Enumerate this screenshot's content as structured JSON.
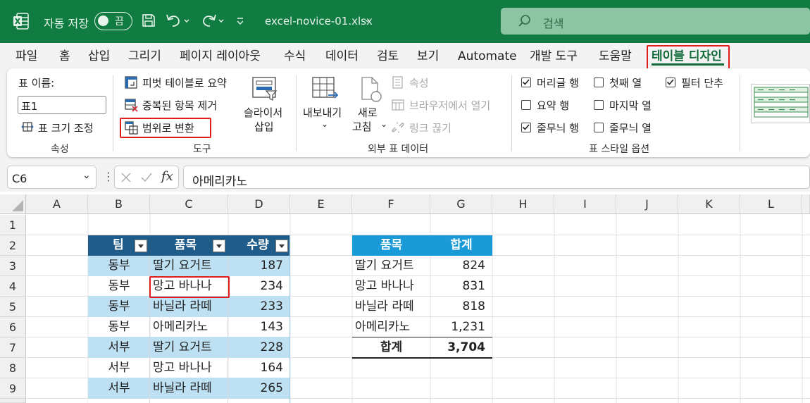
{
  "titlebar": {
    "autosave_label": "자동 저장",
    "autosave_state": "끔",
    "filename": "excel-novice-01.xlsx",
    "search_placeholder": "검색"
  },
  "menu": {
    "items": [
      "파일",
      "홈",
      "삽입",
      "그리기",
      "페이지 레이아웃",
      "수식",
      "데이터",
      "검토",
      "보기",
      "Automate",
      "개발 도구",
      "도움말",
      "테이블 디자인"
    ],
    "active": "테이블 디자인"
  },
  "ribbon": {
    "properties": {
      "name_label": "표 이름:",
      "name_value": "표1",
      "resize_label": "표 크기 조정",
      "group_label": "속성"
    },
    "tools": {
      "pivot_label": "피벗 테이블로 요약",
      "remove_dup_label": "중복된 항목 제거",
      "convert_label": "범위로 변환",
      "slicer_label_1": "슬라이서",
      "slicer_label_2": "삽입",
      "group_label": "도구"
    },
    "external": {
      "export_label": "내보내기",
      "refresh_label_1": "새로",
      "refresh_label_2": "고침",
      "properties_label": "속성",
      "open_browser_label": "브라우저에서 열기",
      "unlink_label": "링크 끊기",
      "group_label": "외부 표 데이터"
    },
    "style_options": {
      "header_row": {
        "label": "머리글 행",
        "checked": true
      },
      "total_row": {
        "label": "요약 행",
        "checked": false
      },
      "banded_rows": {
        "label": "줄무늬 행",
        "checked": true
      },
      "first_column": {
        "label": "첫째 열",
        "checked": false
      },
      "last_column": {
        "label": "마지막 열",
        "checked": false
      },
      "banded_columns": {
        "label": "줄무늬 열",
        "checked": false
      },
      "filter_button": {
        "label": "필터 단추",
        "checked": true
      },
      "group_label": "표 스타일 옵션"
    }
  },
  "formula_bar": {
    "name_box": "C6",
    "formula": "아메리카노"
  },
  "sheet": {
    "columns": [
      "A",
      "B",
      "C",
      "D",
      "E",
      "F",
      "G",
      "H",
      "I",
      "J",
      "K",
      "L"
    ],
    "rows": [
      "1",
      "2",
      "3",
      "4",
      "5",
      "6",
      "7",
      "8",
      "9"
    ],
    "table1": {
      "headers": [
        "팀",
        "품목",
        "수량"
      ],
      "rows": [
        [
          "동부",
          "딸기 요거트",
          "187"
        ],
        [
          "동부",
          "망고 바나나",
          "234"
        ],
        [
          "동부",
          "바닐라 라떼",
          "233"
        ],
        [
          "동부",
          "아메리카노",
          "143"
        ],
        [
          "서부",
          "딸기 요거트",
          "228"
        ],
        [
          "서부",
          "망고 바나나",
          "164"
        ],
        [
          "서부",
          "바닐라 라떼",
          "265"
        ]
      ]
    },
    "summary": {
      "headers": [
        "품목",
        "합계"
      ],
      "rows": [
        [
          "딸기 요거트",
          "824"
        ],
        [
          "망고 바나나",
          "831"
        ],
        [
          "바닐라 라떼",
          "818"
        ],
        [
          "아메리카노",
          "1,231"
        ]
      ],
      "total_label": "합계",
      "total_value": "3,704"
    }
  },
  "colors": {
    "title_bar": "#107c41",
    "table_header": "#1f5c8a",
    "table_band": "#bde0f3",
    "summary_header": "#1a9ad6",
    "highlight": "#e21b1b"
  }
}
